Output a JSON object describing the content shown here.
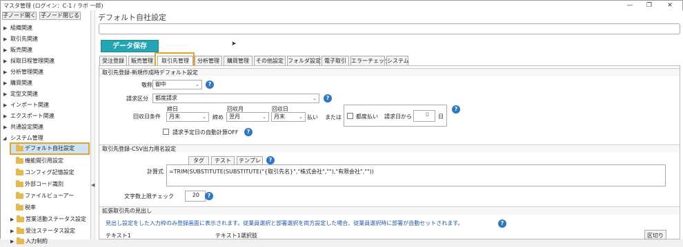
{
  "window": {
    "title": "マスタ管理 (ログイン：C-1 / ラボ 一郎)",
    "min": "—",
    "max": "❐",
    "close": "✕"
  },
  "left": {
    "expand_btn": "子ノード開く",
    "collapse_btn": "子ノード閉じる",
    "tree": [
      {
        "label": "組織関連"
      },
      {
        "label": "取引先関連"
      },
      {
        "label": "販売関連"
      },
      {
        "label": "採取日程管理関連"
      },
      {
        "label": "分析管理関連"
      },
      {
        "label": "購買関連"
      },
      {
        "label": "定型文関連"
      },
      {
        "label": "インポート関連"
      },
      {
        "label": "エクスポート関連"
      },
      {
        "label": "共通設定関連"
      },
      {
        "label": "システム管理"
      }
    ],
    "sub": [
      {
        "label": "デフォルト自社設定"
      },
      {
        "label": "機能間引用設定"
      },
      {
        "label": "コンフィグ記憶設定"
      },
      {
        "label": "外部コード識別"
      },
      {
        "label": "ファイルビューアー"
      },
      {
        "label": "税率"
      },
      {
        "label": "営業活動ステータス設定"
      },
      {
        "label": "受注ステータス設定"
      },
      {
        "label": "入力制約"
      }
    ]
  },
  "main": {
    "title": "デフォルト自社設定",
    "save": "データ保存",
    "tabs": [
      "受注登録",
      "販売管理",
      "取引先管理",
      "分析管理",
      "購買管理",
      "その他設定",
      "フォルダ設定",
      "電子取引",
      "エラーチェック",
      "システム"
    ]
  },
  "sec1": {
    "heading": "取引先登録-新規作成時デフォルト設定",
    "keisho_label": "敬称",
    "keisho_value": "御中",
    "seikyu_label": "請求区分",
    "seikyu_value": "都度請求",
    "kaishu_label": "回収日条件",
    "shime_label": "締日",
    "shime_value": "月末",
    "shime_suffix": "締め",
    "kaishutsuki_label": "回収月",
    "kaishutsuki_value": "翌月",
    "kaishubi_label": "回収日",
    "kaishubi_value": "月末",
    "harai": "払い",
    "matawa": "または",
    "tsudo": "都度払い",
    "seikyubi": "請求日から",
    "days_value": "0",
    "nichi": "日",
    "auto_calc": "請求予定日の自動計算OFF"
  },
  "sec2": {
    "heading": "取引先登録-CSV出力用名設定",
    "tab_tag": "タグ",
    "tab_test": "テスト",
    "tab_tmpl": "テンプレ",
    "formula_label": "計算式",
    "formula": "=TRIM(SUBSTITUTE(SUBSTITUTE(\"{取引先名}\",\"株式会社\",\"\"),\"有限会社\",\"\"))",
    "limit_label": "文字数上限チェック",
    "limit_value": "20"
  },
  "sec3": {
    "heading": "拡張取引先の見出し",
    "note": "見出し設定をした入力枠のみ登録画面に表示されます。従業員選択と部署選択を両方設定した場合、従業員選択時に部署が自動セットされます。",
    "col1": "テキスト1",
    "col2": "テキスト1選択肢",
    "col3": "区切り"
  },
  "icons": {
    "help": "?",
    "dropdown": "⌄",
    "tri_closed": "▶",
    "tri_open": "◢",
    "pointer": "➤",
    "splitter_arrow": "◀"
  },
  "colors": {
    "accent": "#22a6b3",
    "highlight": "#f0a020",
    "help": "#2b78c8"
  }
}
